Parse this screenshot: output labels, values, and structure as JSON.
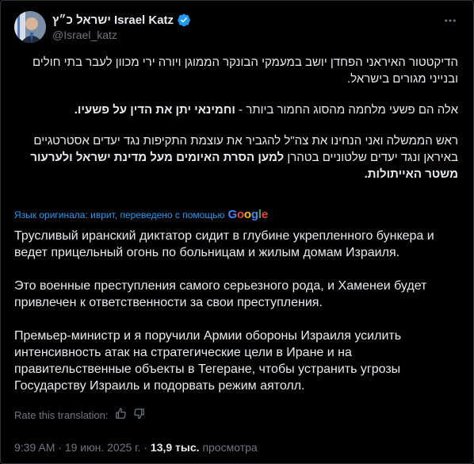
{
  "author": {
    "display_name": "ישראל כ״ץ Israel Katz",
    "handle": "@Israel_katz",
    "verified_color": "#1d9bf0"
  },
  "original": {
    "p1": "הדיקטטור האיראני הפחדן יושב במעמקי הבונקר הממוגן ויורה ירי מכוון לעבר בתי חולים ובנייני מגורים בישראל.",
    "p2_regular": "אלה הם פשעי מלחמה מהסוג החמור ביותר - ",
    "p2_bold": "וחמינאי יתן את הדין על פשעיו.",
    "p3_regular": "ראש הממשלה ואני הנחינו את צה\"ל להגביר את עוצמת התקיפות נגד יעדים אסטרטגיים באיראן ונגד יעדים שלטוניים בטהרן ",
    "p3_bold": "למען הסרת האיומים מעל מדינת ישראל ולערעור משטר האייתולות."
  },
  "translation_note": {
    "text": "Язык оригинала: иврит, переведено с помощью",
    "provider": "Google"
  },
  "translation": {
    "p1": "Трусливый иранский диктатор сидит в глубине укрепленного бункера и ведет прицельный огонь по больницам и жилым домам Израиля.",
    "p2": "Это военные преступления самого серьезного рода, и Хаменеи будет привлечен к ответственности за свои преступления.",
    "p3": "Премьер-министр и я поручили Армии обороны Израиля усилить интенсивность атак на стратегические цели в Иране и на правительственные объекты в Тегеране, чтобы устранить угрозы Государству Израиль и подорвать режим аятолл."
  },
  "rate": {
    "label": "Rate this translation:"
  },
  "meta": {
    "time": "9:39 AM",
    "date": "19 июн. 2025 г.",
    "views": "13,9 тыс.",
    "views_label": "просмотра"
  }
}
